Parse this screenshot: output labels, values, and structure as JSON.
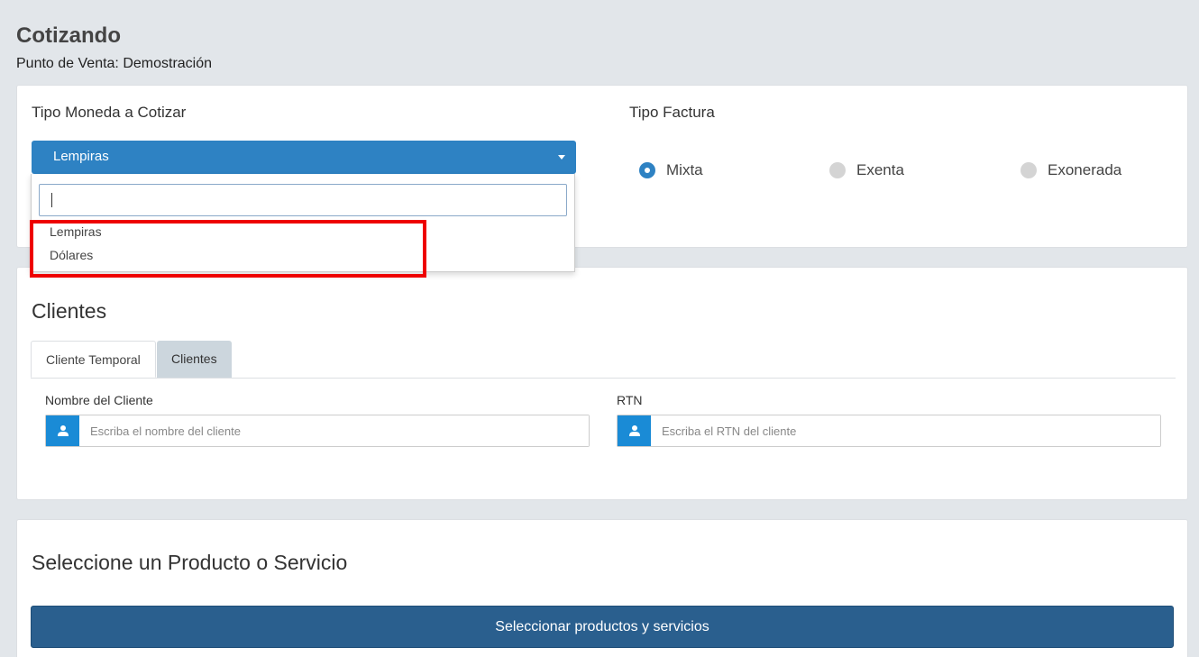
{
  "header": {
    "title": "Cotizando",
    "subtitle": "Punto de Venta: Demostración"
  },
  "currency": {
    "label": "Tipo Moneda a Cotizar",
    "selected": "Lempiras",
    "search_value": "",
    "options": [
      "Lempiras",
      "Dólares"
    ]
  },
  "invoice_type": {
    "label": "Tipo Factura",
    "options": [
      {
        "label": "Mixta",
        "checked": true
      },
      {
        "label": "Exenta",
        "checked": false
      },
      {
        "label": "Exonerada",
        "checked": false
      }
    ]
  },
  "clients": {
    "title": "Clientes",
    "tabs": [
      {
        "label": "Cliente Temporal",
        "active": true
      },
      {
        "label": "Clientes",
        "active": false
      }
    ],
    "name_field": {
      "label": "Nombre del Cliente",
      "placeholder": "Escriba el nombre del cliente",
      "value": ""
    },
    "rtn_field": {
      "label": "RTN",
      "placeholder": "Escriba el RTN del cliente",
      "value": ""
    }
  },
  "products": {
    "title": "Seleccione un Producto o Servicio",
    "button_label": "Seleccionar productos y servicios"
  },
  "colors": {
    "accent": "#2e82c3",
    "addon": "#1a8bd6",
    "primary_button": "#2a5f8e",
    "highlight": "#ee0000"
  },
  "icons": [
    "caret-down-icon",
    "user-icon"
  ]
}
